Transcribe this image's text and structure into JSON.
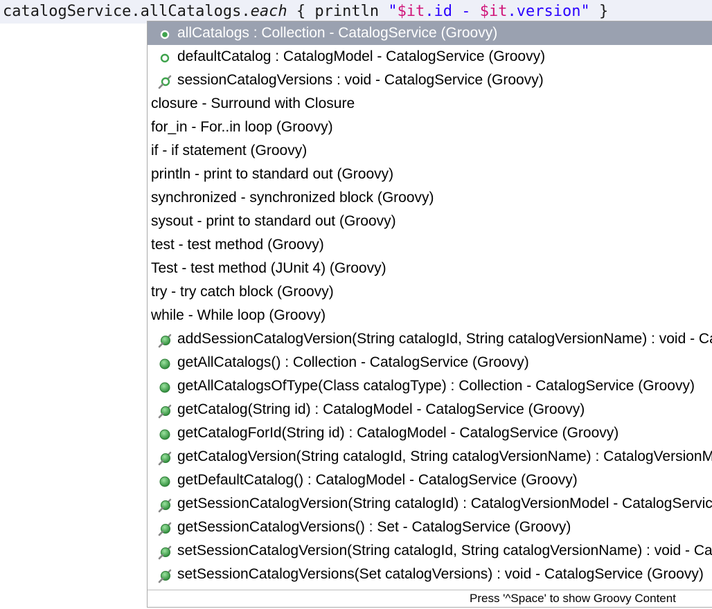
{
  "editor": {
    "segments": [
      {
        "text": "catalogService.allCatalogs.",
        "style": "plain"
      },
      {
        "text": "each",
        "style": "italic"
      },
      {
        "text": " { println ",
        "style": "plain"
      },
      {
        "text": "\"",
        "style": "str"
      },
      {
        "text": "$it",
        "style": "tpl"
      },
      {
        "text": ".id - ",
        "style": "str"
      },
      {
        "text": "$it",
        "style": "tpl"
      },
      {
        "text": ".version\"",
        "style": "str"
      },
      {
        "text": " }",
        "style": "plain"
      }
    ]
  },
  "popup": {
    "selected_index": 0,
    "items": [
      {
        "label": "allCatalogs : Collection - CatalogService (Groovy)",
        "icon": "field-icon"
      },
      {
        "label": "defaultCatalog : CatalogModel - CatalogService (Groovy)",
        "icon": "field-icon"
      },
      {
        "label": "sessionCatalogVersions : void - CatalogService (Groovy)",
        "icon": "property-setter-icon"
      },
      {
        "label": "closure - Surround with Closure",
        "icon": null
      },
      {
        "label": "for_in - For..in loop (Groovy)",
        "icon": null
      },
      {
        "label": "if - if statement (Groovy)",
        "icon": null
      },
      {
        "label": "println - print to standard out (Groovy)",
        "icon": null
      },
      {
        "label": "synchronized - synchronized block (Groovy)",
        "icon": null
      },
      {
        "label": "sysout - print to standard out (Groovy)",
        "icon": null
      },
      {
        "label": "test - test method (Groovy)",
        "icon": null
      },
      {
        "label": "Test - test method (JUnit 4) (Groovy)",
        "icon": null
      },
      {
        "label": "try - try catch block (Groovy)",
        "icon": null
      },
      {
        "label": "while - While loop (Groovy)",
        "icon": null
      },
      {
        "label": "addSessionCatalogVersion(String catalogId, String catalogVersionName) : void - CatalogService (Groovy)",
        "icon": "method-setter-icon"
      },
      {
        "label": "getAllCatalogs() : Collection - CatalogService (Groovy)",
        "icon": "method-icon"
      },
      {
        "label": "getAllCatalogsOfType(Class catalogType) : Collection - CatalogService (Groovy)",
        "icon": "method-icon"
      },
      {
        "label": "getCatalog(String id) : CatalogModel - CatalogService (Groovy)",
        "icon": "method-setter-icon"
      },
      {
        "label": "getCatalogForId(String id) : CatalogModel - CatalogService (Groovy)",
        "icon": "method-icon"
      },
      {
        "label": "getCatalogVersion(String catalogId, String catalogVersionName) : CatalogVersionModel - CatalogService (Groovy)",
        "icon": "method-setter-icon"
      },
      {
        "label": "getDefaultCatalog() : CatalogModel - CatalogService (Groovy)",
        "icon": "method-icon"
      },
      {
        "label": "getSessionCatalogVersion(String catalogId) : CatalogVersionModel - CatalogService (Groovy)",
        "icon": "method-setter-icon"
      },
      {
        "label": "getSessionCatalogVersions() : Set - CatalogService (Groovy)",
        "icon": "method-setter-icon"
      },
      {
        "label": "setSessionCatalogVersion(String catalogId, String catalogVersionName) : void - CatalogService (Groovy)",
        "icon": "method-setter-icon"
      },
      {
        "label": "setSessionCatalogVersions(Set catalogVersions) : void - CatalogService (Groovy)",
        "icon": "method-setter-icon"
      }
    ],
    "status": "Press '^Space' to show Groovy Content"
  },
  "colors": {
    "selection": "#9aa1b0",
    "method_green": "#3fa34d",
    "keyword_pink": "#d0167a",
    "string_blue": "#2a00ff"
  }
}
